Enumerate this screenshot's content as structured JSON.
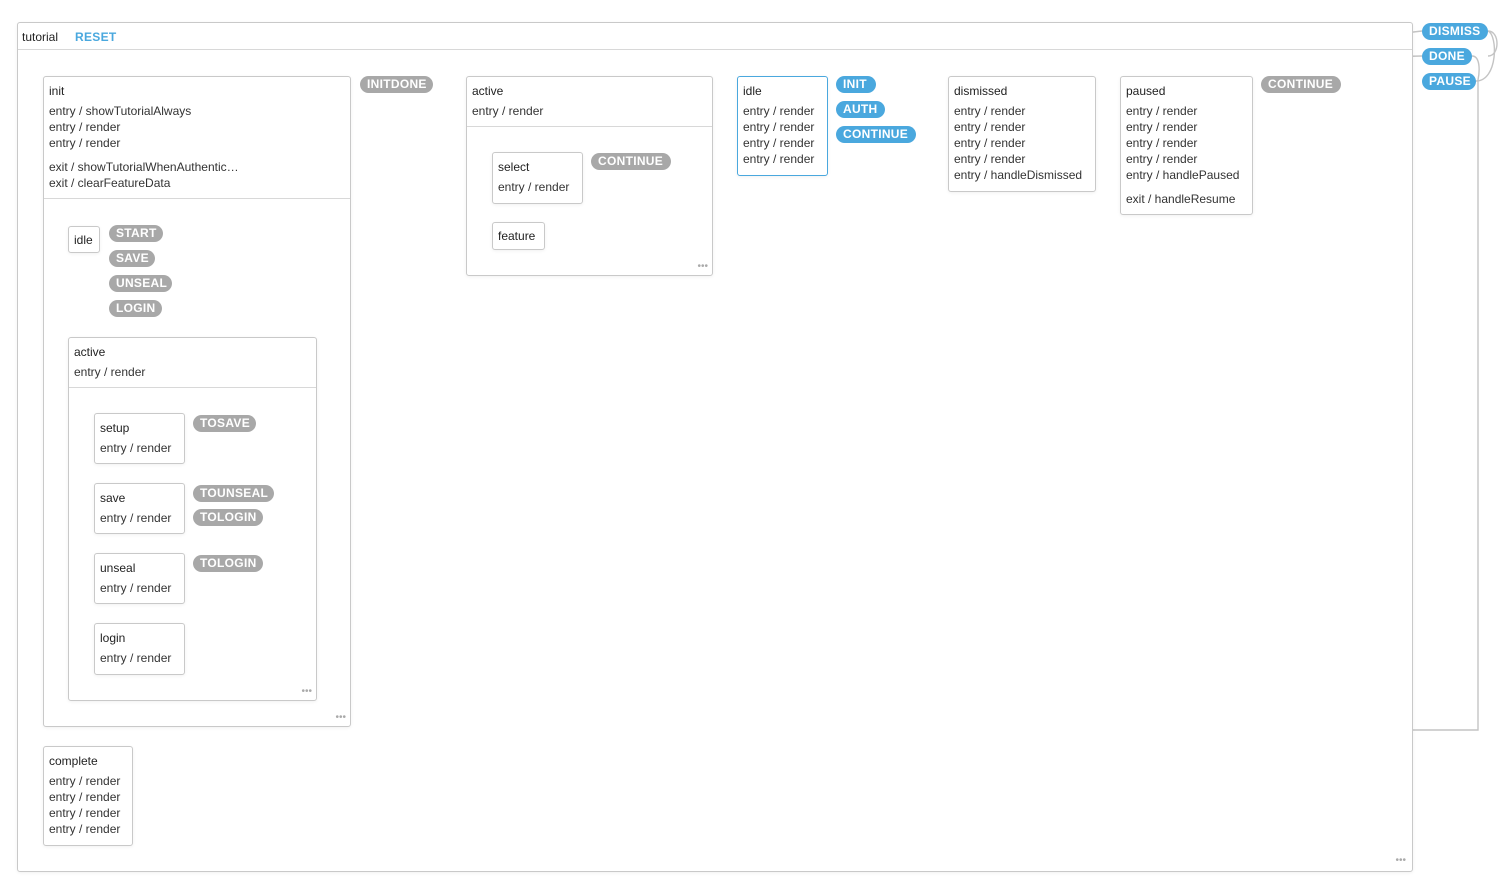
{
  "machine": {
    "name": "tutorial",
    "reset_label": "RESET"
  },
  "global_events": [
    "DISMISS",
    "DONE",
    "PAUSE"
  ],
  "init": {
    "name": "init",
    "entry": [
      "entry / showTutorialAlways",
      "entry / render",
      "entry / render"
    ],
    "exit": [
      "exit / showTutorialWhenAuthentic…",
      "exit / clearFeatureData"
    ],
    "event": "INITDONE",
    "idle": {
      "name": "idle",
      "events": [
        "START",
        "SAVE",
        "UNSEAL",
        "LOGIN"
      ]
    },
    "active": {
      "name": "active",
      "entry": "entry / render",
      "setup": {
        "name": "setup",
        "entry": "entry / render",
        "event": "TOSAVE"
      },
      "save": {
        "name": "save",
        "entry": "entry / render",
        "events": [
          "TOUNSEAL",
          "TOLOGIN"
        ]
      },
      "unseal": {
        "name": "unseal",
        "entry": "entry / render",
        "event": "TOLOGIN"
      },
      "login": {
        "name": "login",
        "entry": "entry / render"
      }
    }
  },
  "active": {
    "name": "active",
    "entry": "entry / render",
    "select": {
      "name": "select",
      "entry": "entry / render",
      "event": "CONTINUE"
    },
    "feature": {
      "name": "feature"
    }
  },
  "idle": {
    "name": "idle",
    "entry": [
      "entry / render",
      "entry / render",
      "entry / render",
      "entry / render"
    ],
    "events": [
      "INIT",
      "AUTH",
      "CONTINUE"
    ]
  },
  "dismissed": {
    "name": "dismissed",
    "entry": [
      "entry / render",
      "entry / render",
      "entry / render",
      "entry / render",
      "entry / handleDismissed"
    ]
  },
  "paused": {
    "name": "paused",
    "entry": [
      "entry / render",
      "entry / render",
      "entry / render",
      "entry / render",
      "entry / handlePaused"
    ],
    "exit": [
      "exit / handleResume"
    ],
    "event": "CONTINUE"
  },
  "complete": {
    "name": "complete",
    "entry": [
      "entry / render",
      "entry / render",
      "entry / render",
      "entry / render"
    ]
  },
  "colors": {
    "accent": "#4aa8de",
    "event_gray": "#a8a8a8",
    "border": "#c9c9c9",
    "wire": "#c4c4c4"
  }
}
